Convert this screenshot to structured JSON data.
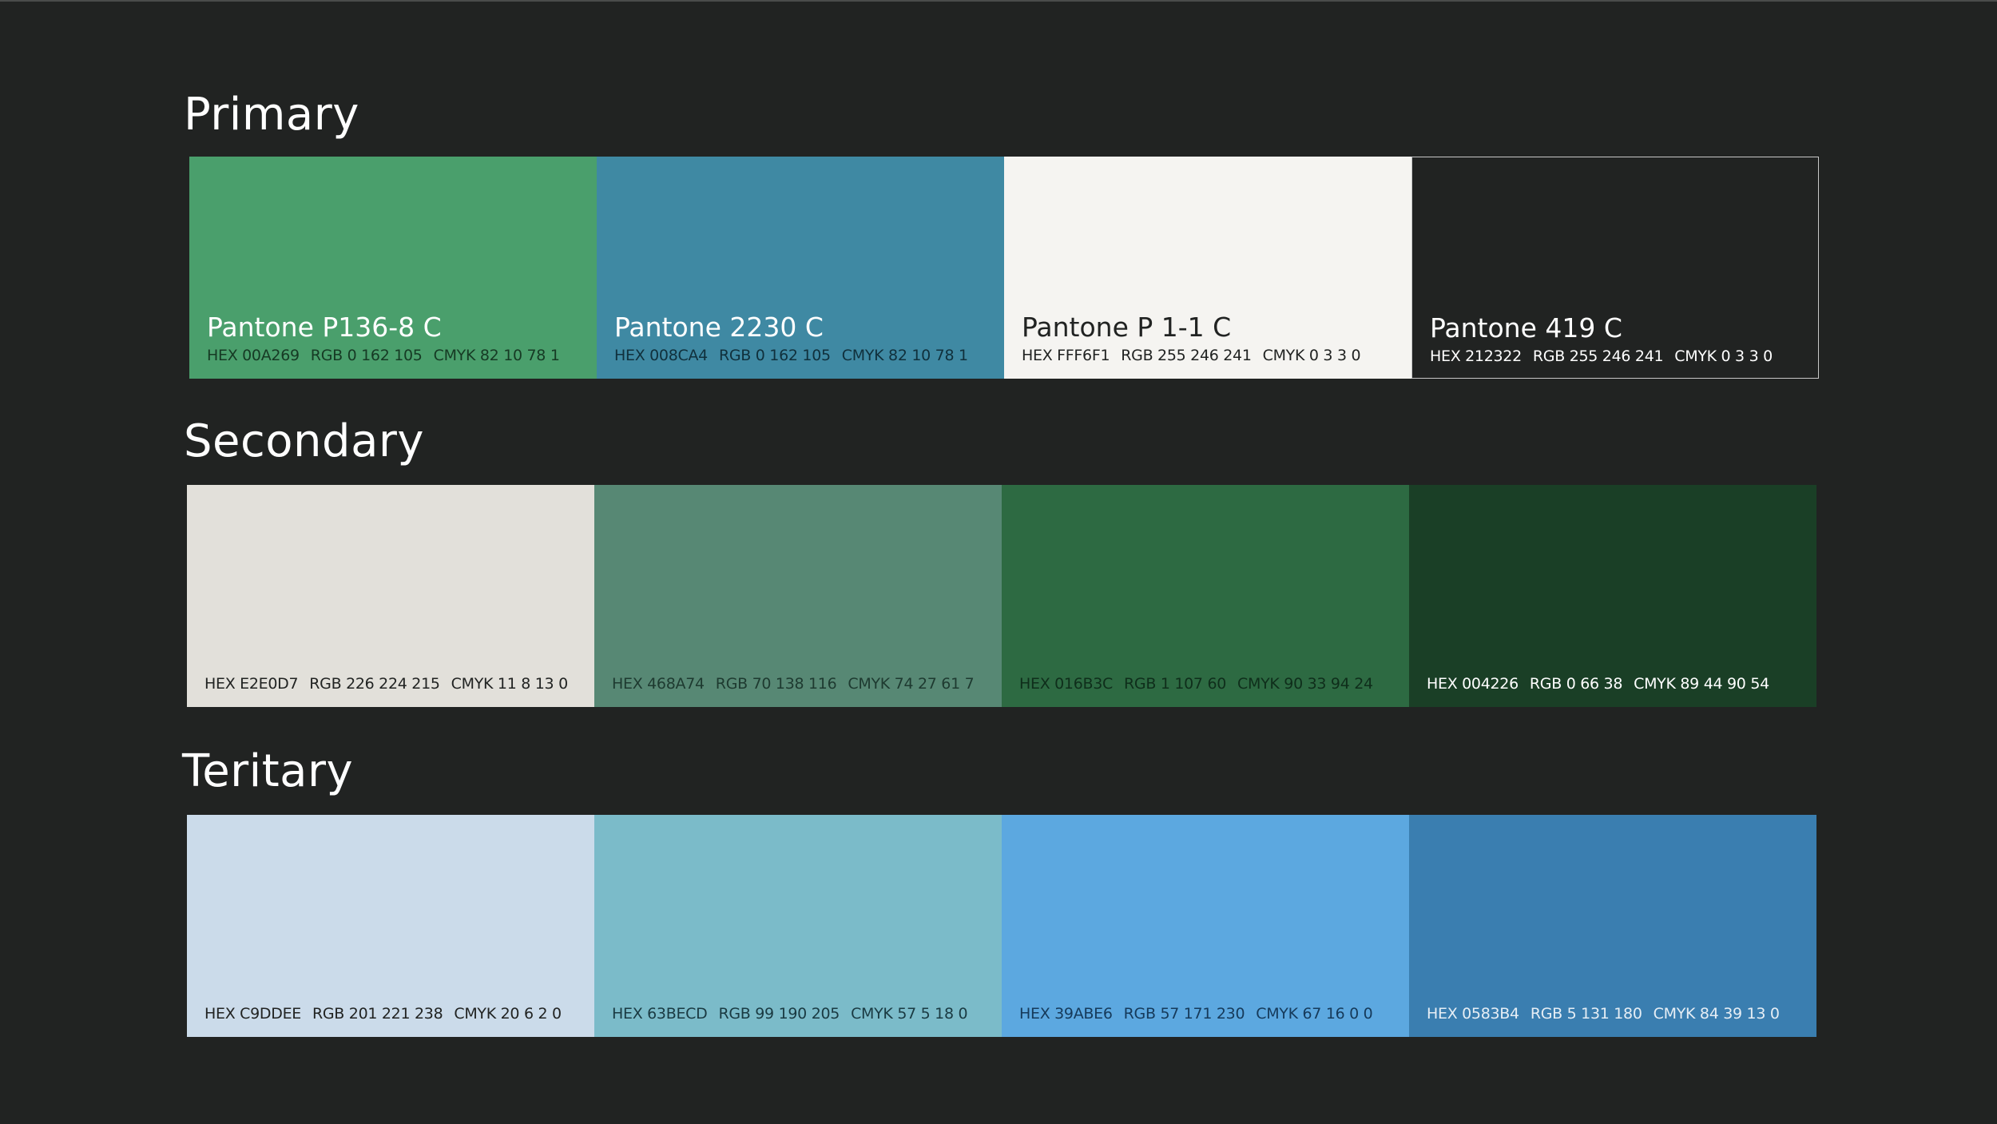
{
  "sections": [
    {
      "title": "Primary",
      "swatches": [
        {
          "name": "Pantone P136-8 C",
          "hex": "HEX 00A269",
          "rgb": "RGB 0 162 105",
          "cmyk": "CMYK 82 10 78 1",
          "fill": "#4a9f6c",
          "text_color": "#ffffff",
          "specs_color": "#163a24"
        },
        {
          "name": "Pantone 2230 C",
          "hex": "HEX 008CA4",
          "rgb": "RGB 0 162 105",
          "cmyk": "CMYK 82 10 78 1",
          "fill": "#3f89a3",
          "text_color": "#ffffff",
          "specs_color": "#10303c"
        },
        {
          "name": "Pantone P 1-1 C",
          "hex": "HEX FFF6F1",
          "rgb": "RGB 255 246 241",
          "cmyk": "CMYK 0 3 3 0",
          "fill": "#f5f4f1",
          "text_color": "#212322",
          "specs_color": "#212322"
        },
        {
          "name": "Pantone 419 C",
          "hex": "HEX 212322",
          "rgb": "RGB 255 246 241",
          "cmyk": "CMYK 0 3 3 0",
          "fill": "#212322",
          "text_color": "#ffffff",
          "specs_color": "#ffffff",
          "outlined": true
        }
      ]
    },
    {
      "title": "Secondary",
      "swatches": [
        {
          "name": "",
          "hex": "HEX E2E0D7",
          "rgb": "RGB 226 224 215",
          "cmyk": "CMYK 11 8 13 0",
          "fill": "#e2e0da",
          "text_color": "#212322",
          "specs_color": "#212322"
        },
        {
          "name": "",
          "hex": "HEX 468A74",
          "rgb": "RGB 70 138 116",
          "cmyk": "CMYK 74 27 61 7",
          "fill": "#578874",
          "text_color": "#ffffff",
          "specs_color": "#1e3a30"
        },
        {
          "name": "",
          "hex": "HEX 016B3C",
          "rgb": "RGB 1 107 60",
          "cmyk": "CMYK 90 33 94 24",
          "fill": "#2d6a42",
          "text_color": "#ffffff",
          "specs_color": "#0f2e1b"
        },
        {
          "name": "",
          "hex": "HEX 004226",
          "rgb": "RGB 0 66 38",
          "cmyk": "CMYK 89 44 90 54",
          "fill": "#1a3f26",
          "text_color": "#ffffff",
          "specs_color": "#ffffff"
        }
      ]
    },
    {
      "title": "Teritary",
      "swatches": [
        {
          "name": "",
          "hex": "HEX C9DDEE",
          "rgb": "RGB 201 221 238",
          "cmyk": "CMYK 20 6 2 0",
          "fill": "#cbdbea",
          "text_color": "#212322",
          "specs_color": "#212322"
        },
        {
          "name": "",
          "hex": "HEX 63BECD",
          "rgb": "RGB 99 190 205",
          "cmyk": "CMYK 57 5 18 0",
          "fill": "#7bbbc9",
          "text_color": "#212322",
          "specs_color": "#1a3a42"
        },
        {
          "name": "",
          "hex": "HEX 39ABE6",
          "rgb": "RGB 57 171 230",
          "cmyk": "CMYK 67 16 0 0",
          "fill": "#5ca8e0",
          "text_color": "#212322",
          "specs_color": "#163a5a"
        },
        {
          "name": "",
          "hex": "HEX 0583B4",
          "rgb": "RGB 5 131 180",
          "cmyk": "CMYK 84 39 13 0",
          "fill": "#3a7eb0",
          "text_color": "#ffffff",
          "specs_color": "#e6eef5"
        }
      ]
    }
  ]
}
